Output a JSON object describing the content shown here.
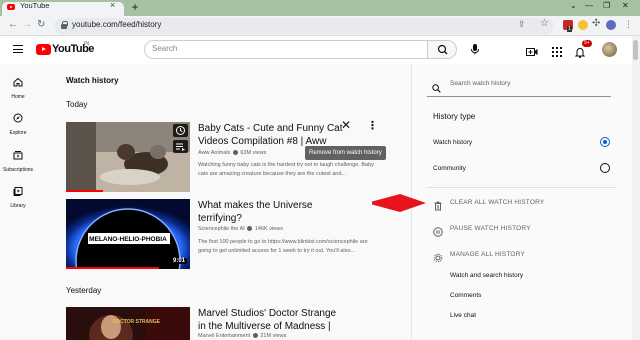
{
  "browser": {
    "tab_title": "YouTube",
    "tab_close": "×",
    "new_tab": "+",
    "url": "youtube.com/feed/history",
    "window_controls": [
      "⌄",
      "—",
      "❐",
      "✕"
    ],
    "ext_badge": "1"
  },
  "header": {
    "logo_text": "YouTube",
    "logo_superscript": "IN",
    "search_placeholder": "Search",
    "notification_count": "9+"
  },
  "guide": [
    {
      "label": "Home",
      "icon": "home-icon"
    },
    {
      "label": "Explore",
      "icon": "compass-icon"
    },
    {
      "label": "Subscriptions",
      "icon": "subscriptions-icon"
    },
    {
      "label": "Library",
      "icon": "library-icon"
    }
  ],
  "main": {
    "title": "Watch history",
    "sections": [
      "Today",
      "Yesterday"
    ],
    "videos": [
      {
        "title": "Baby Cats - Cute and Funny Cat Videos Compilation #8 | Aww",
        "channel": "Aww Animals",
        "views": "63M views",
        "description": "Watching funny baby cats is the hardest try not to laugh challenge. Baby cats are amazing creature because they are the cutest and...",
        "progress": 0.3
      },
      {
        "title": "What makes the Universe terrifying?",
        "channel": "Sciencephile the AI",
        "views": "146K views",
        "description": "The first 100 people to go to https://www.blinkist.com/sciencephile are going to get unlimited access for 1 week to try it out. You'll also...",
        "duration": "9:01",
        "thumb_text": "MELANO-HELIO-PHOBIA",
        "progress": 0.75
      },
      {
        "title": "Marvel Studios' Doctor Strange in the Multiverse of Madness |",
        "channel": "Marvel Entertainment",
        "views": "21M views",
        "thumb_text": "DOCTOR STRANGE"
      }
    ],
    "tooltip": "Remove from watch history",
    "close_glyph": "✕",
    "more_glyph": "⋮"
  },
  "panel": {
    "search_placeholder": "Search watch history",
    "history_type_label": "History type",
    "options": [
      {
        "label": "Watch history",
        "selected": true
      },
      {
        "label": "Community",
        "selected": false
      }
    ],
    "actions": [
      "CLEAR ALL WATCH HISTORY",
      "PAUSE WATCH HISTORY",
      "MANAGE ALL HISTORY"
    ],
    "sub_links": [
      "Watch and search history",
      "Comments",
      "Live chat"
    ]
  },
  "colors": {
    "accent_blue": "#065fd4",
    "yt_red": "#ff0000",
    "annotation_arrow": "#e8141b",
    "chrome_frame": "#a7c0a3"
  }
}
